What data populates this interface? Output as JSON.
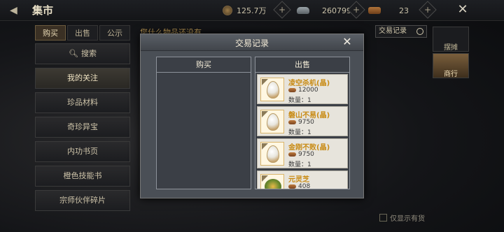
{
  "header": {
    "title": "集市",
    "resources": [
      {
        "icon": "copper-coin-icon",
        "value": "125.7万"
      },
      {
        "icon": "silver-ingot-icon",
        "value": "260799"
      },
      {
        "icon": "scroll-token-icon",
        "value": "23"
      }
    ]
  },
  "left_tabs": [
    "购买",
    "出售",
    "公示"
  ],
  "sidebar": {
    "items": [
      {
        "label": "搜索",
        "icon": "search-icon"
      },
      {
        "label": "我的关注"
      },
      {
        "label": "珍品材料"
      },
      {
        "label": "奇珍异宝"
      },
      {
        "label": "内功书页"
      },
      {
        "label": "橙色技能书"
      },
      {
        "label": "宗师伙伴碎片"
      }
    ]
  },
  "notice_text": "您什么物品还没有",
  "record_button_label": "交易记录",
  "right_col": [
    "摆摊",
    "商行"
  ],
  "only_in_stock_label": "仅显示有货",
  "dialog": {
    "title": "交易记录",
    "buy_header": "购买",
    "sell_header": "出售",
    "qty_prefix": "数量：",
    "sell_items": [
      {
        "name": "凌空杀机(晶)",
        "price": "12000",
        "qty": "1",
        "icon": "crystal-egg-icon"
      },
      {
        "name": "磐山不易(晶)",
        "price": "9750",
        "qty": "1",
        "icon": "crystal-egg-icon"
      },
      {
        "name": "金刚不败(晶)",
        "price": "9750",
        "qty": "1",
        "icon": "crystal-egg-icon"
      },
      {
        "name": "元灵芝",
        "price": "408",
        "qty": "",
        "icon": "lingzhi-herb-icon"
      }
    ]
  },
  "colors": {
    "accent_gold": "#c88a12",
    "dialog_bg": "#4a4f56"
  }
}
